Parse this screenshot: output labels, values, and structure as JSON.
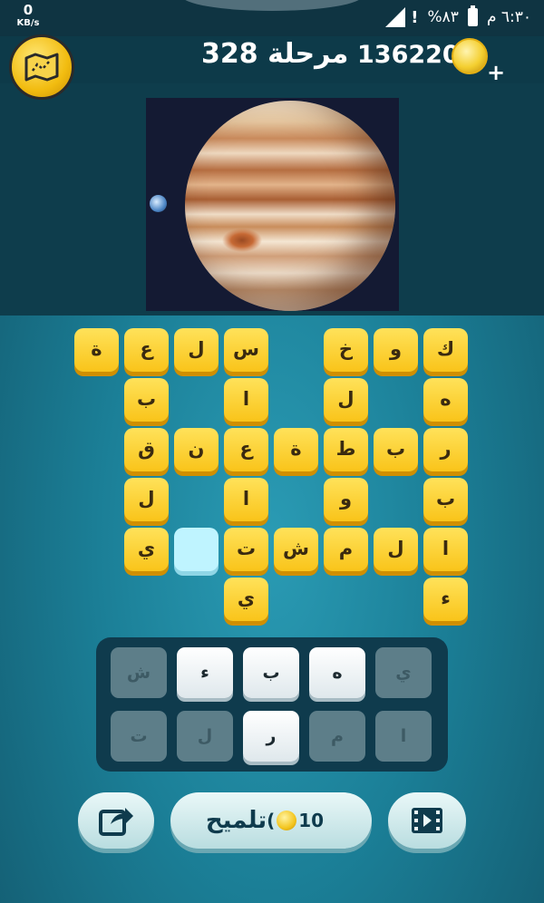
{
  "status_bar": {
    "speed": "0",
    "speed_unit": "KB/s",
    "time": "٦:٣٠ م",
    "battery": "%٨٣"
  },
  "header": {
    "level_label": "مرحلة",
    "level_number": "328",
    "coins": "1362202"
  },
  "board_rows": [
    [
      "ك",
      "و",
      "خ",
      "",
      "س",
      "ل",
      "ع",
      "ة"
    ],
    [
      "ه",
      "",
      "ل",
      "",
      "ا",
      "",
      "ب",
      ""
    ],
    [
      "ر",
      "ب",
      "ط",
      "ة",
      "ع",
      "ن",
      "ق",
      ""
    ],
    [
      "ب",
      "",
      "و",
      "",
      "ا",
      "",
      "ل",
      ""
    ],
    [
      "ا",
      "ل",
      "م",
      "ش",
      "ت",
      "",
      "ي",
      ""
    ],
    [
      "ء",
      "",
      "",
      "",
      "ي",
      "",
      "",
      ""
    ]
  ],
  "empty_cell_row": 4,
  "empty_cell_col": 5,
  "keyboard": {
    "row1": [
      {
        "letter": "ي",
        "used": true
      },
      {
        "letter": "ه",
        "used": false
      },
      {
        "letter": "ب",
        "used": false
      },
      {
        "letter": "ء",
        "used": false
      },
      {
        "letter": "ش",
        "used": true
      }
    ],
    "row2": [
      {
        "letter": "ا",
        "used": true
      },
      {
        "letter": "م",
        "used": true
      },
      {
        "letter": "ر",
        "used": false
      },
      {
        "letter": "ل",
        "used": true
      },
      {
        "letter": "ت",
        "used": true
      }
    ]
  },
  "hint": {
    "label": "تلميح",
    "cost_open": "(",
    "cost": "10"
  },
  "colors": {
    "tile": "#f9c41a",
    "tile_text": "#3a2a10",
    "empty": "#bff4ff",
    "panel": "#0f3b4d"
  }
}
